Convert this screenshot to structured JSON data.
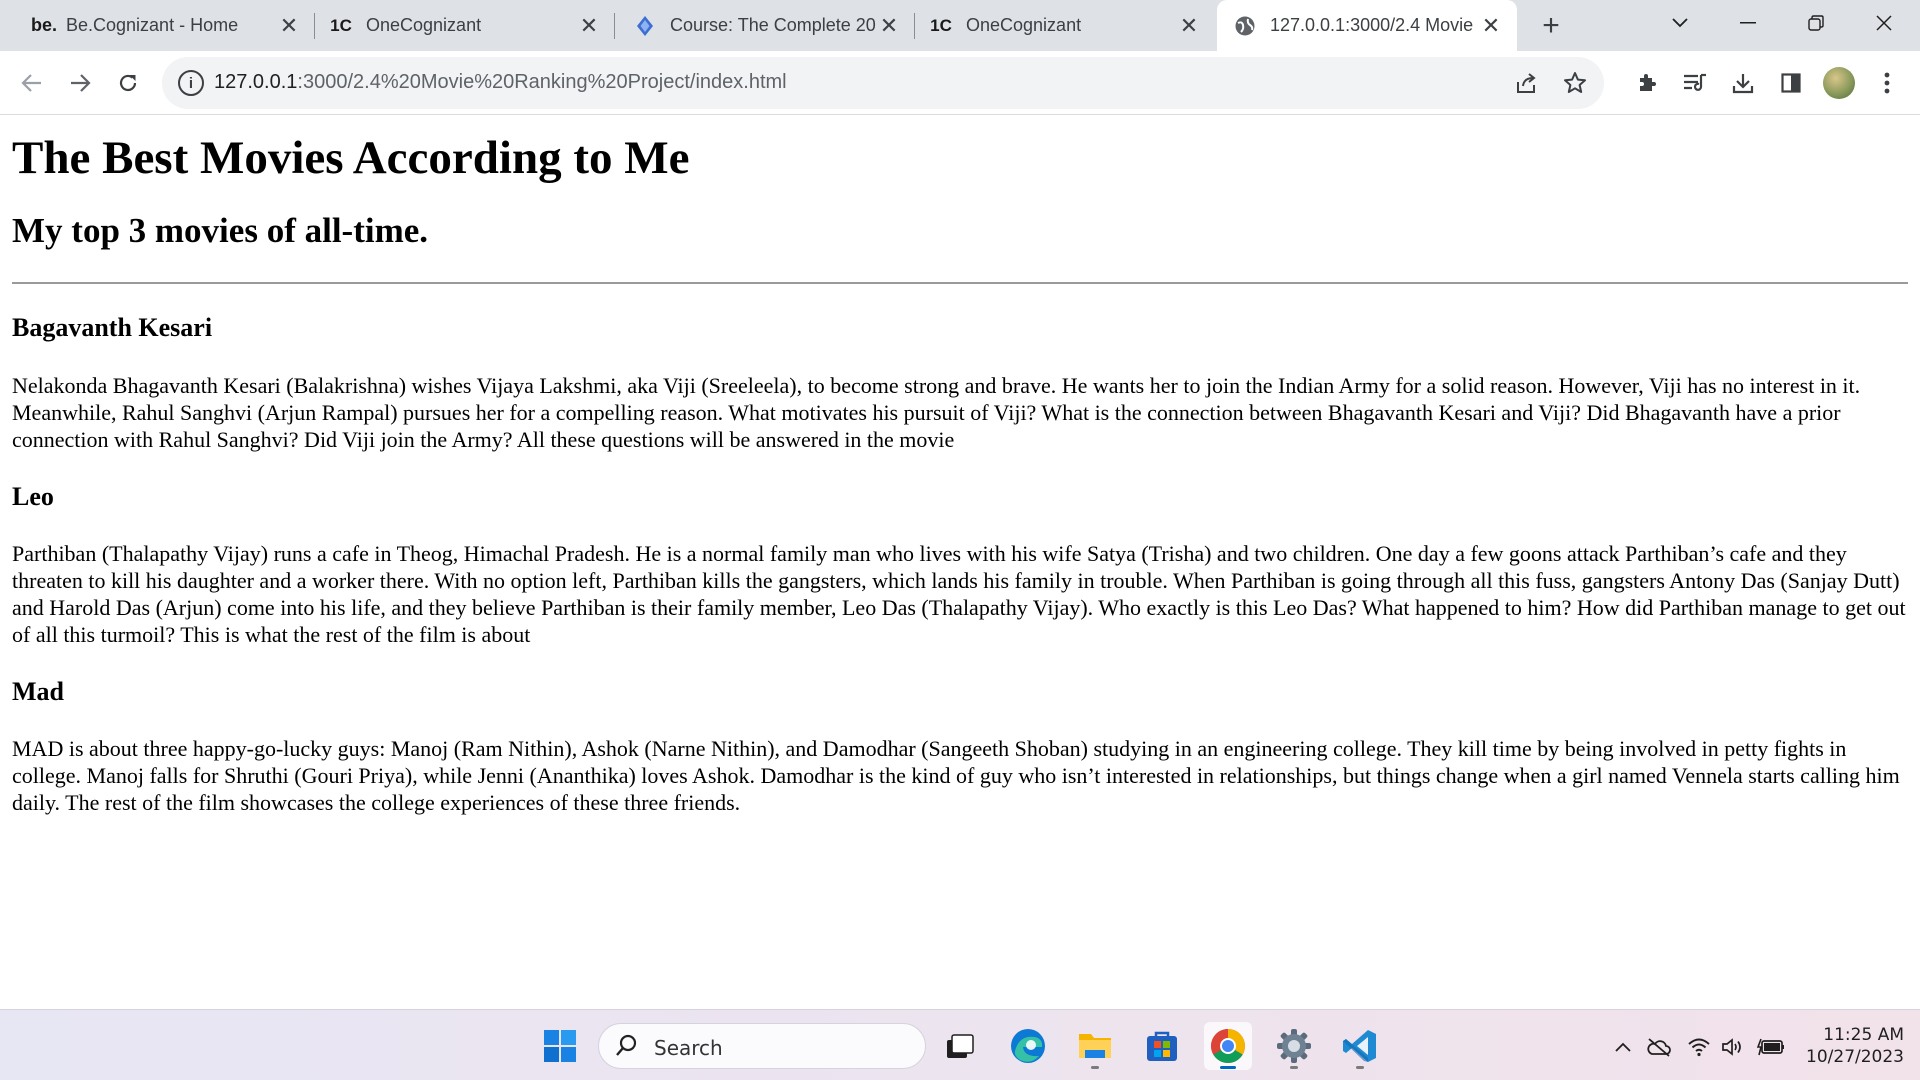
{
  "browser": {
    "tabs": [
      {
        "icon": "becognizant-icon",
        "favicon_text": "be.",
        "title": "Be.Cognizant - Home",
        "active": false
      },
      {
        "icon": "onecognizant-icon",
        "favicon_text": "1C",
        "title": "OneCognizant",
        "active": false
      },
      {
        "icon": "course-icon",
        "favicon_text": "",
        "title": "Course: The Complete 20",
        "active": false
      },
      {
        "icon": "onecognizant-icon",
        "favicon_text": "1C",
        "title": "OneCognizant",
        "active": false
      },
      {
        "icon": "globe-icon",
        "favicon_text": "",
        "title": "127.0.0.1:3000/2.4 Movie",
        "active": true
      }
    ],
    "url": {
      "host": "127.0.0.1",
      "rest": ":3000/2.4%20Movie%20Ranking%20Project/index.html"
    }
  },
  "page": {
    "heading": "The Best Movies According to Me",
    "subheading": "My top 3 movies of all-time.",
    "movies": [
      {
        "title": "Bagavanth Kesari",
        "description": "Nelakonda Bhagavanth Kesari (Balakrishna) wishes Vijaya Lakshmi, aka Viji (Sreeleela), to become strong and brave. He wants her to join the Indian Army for a solid reason. However, Viji has no interest in it. Meanwhile, Rahul Sanghvi (Arjun Rampal) pursues her for a compelling reason. What motivates his pursuit of Viji? What is the connection between Bhagavanth Kesari and Viji? Did Bhagavanth have a prior connection with Rahul Sanghvi? Did Viji join the Army? All these questions will be answered in the movie"
      },
      {
        "title": "Leo",
        "description": "Parthiban (Thalapathy Vijay) runs a cafe in Theog, Himachal Pradesh. He is a normal family man who lives with his wife Satya (Trisha) and two children. One day a few goons attack Parthiban’s cafe and they threaten to kill his daughter and a worker there. With no option left, Parthiban kills the gangsters, which lands his family in trouble. When Parthiban is going through all this fuss, gangsters Antony Das (Sanjay Dutt) and Harold Das (Arjun) come into his life, and they believe Parthiban is their family member, Leo Das (Thalapathy Vijay). Who exactly is this Leo Das? What happened to him? How did Parthiban manage to get out of all this turmoil? This is what the rest of the film is about"
      },
      {
        "title": "Mad",
        "description": "MAD is about three happy-go-lucky guys: Manoj (Ram Nithin), Ashok (Narne Nithin), and Damodhar (Sangeeth Shoban) studying in an engineering college. They kill time by being involved in petty fights in college. Manoj falls for Shruthi (Gouri Priya), while Jenni (Ananthika) loves Ashok. Damodhar is the kind of guy who isn’t interested in relationships, but things change when a girl named Vennela starts calling him daily. The rest of the film showcases the college experiences of these three friends."
      }
    ]
  },
  "taskbar": {
    "search_label": "Search",
    "time": "11:25 AM",
    "date": "10/27/2023"
  },
  "colors": {
    "tabstrip": "#dee1e6",
    "omnibox": "#f1f3f4",
    "taskbar_active_indicator": "#0067c0"
  }
}
